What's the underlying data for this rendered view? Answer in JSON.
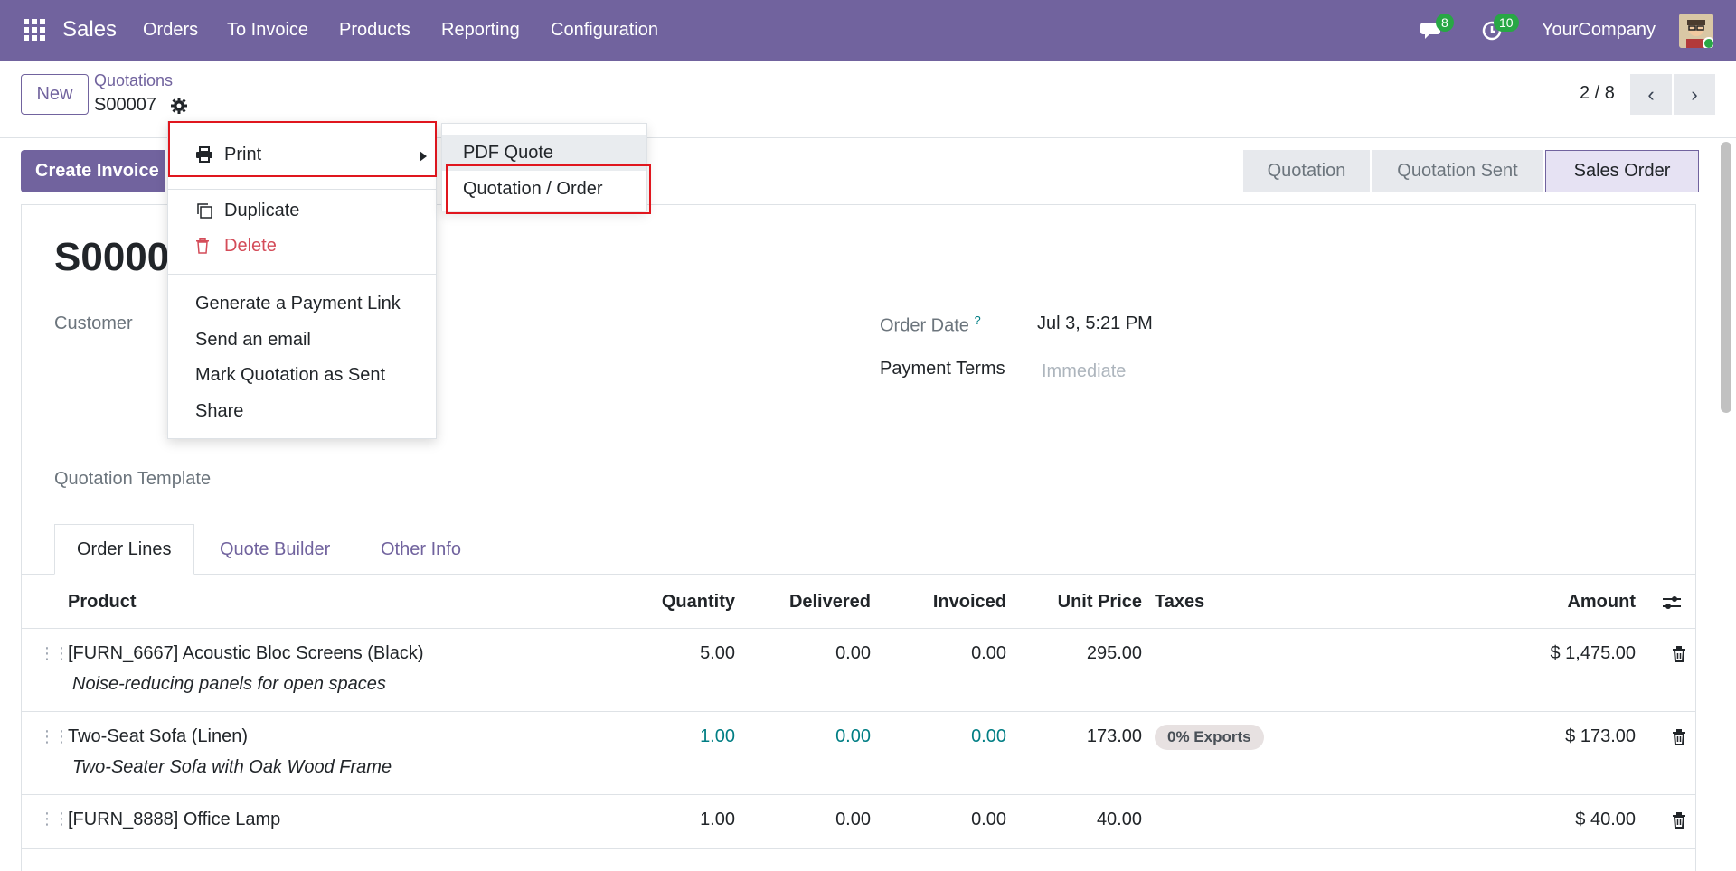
{
  "navbar": {
    "app": "Sales",
    "menus": [
      "Orders",
      "To Invoice",
      "Products",
      "Reporting",
      "Configuration"
    ],
    "messages_count": "8",
    "activities_count": "10",
    "company": "YourCompany"
  },
  "control": {
    "new_label": "New",
    "breadcrumb": "Quotations",
    "record": "S00007",
    "pager": "2 / 8"
  },
  "actions": {
    "create_invoice": "Create Invoice"
  },
  "statusbar": [
    "Quotation",
    "Quotation Sent",
    "Sales Order"
  ],
  "form": {
    "title": "S0000",
    "customer_label": "Customer",
    "order_date_label": "Order Date",
    "order_date_help": "?",
    "order_date": "Jul 3, 5:21 PM",
    "payment_terms_label": "Payment Terms",
    "payment_terms_placeholder": "Immediate",
    "template_label": "Quotation Template"
  },
  "tabs": [
    "Order Lines",
    "Quote Builder",
    "Other Info"
  ],
  "table": {
    "headers": {
      "product": "Product",
      "quantity": "Quantity",
      "delivered": "Delivered",
      "invoiced": "Invoiced",
      "unit_price": "Unit Price",
      "taxes": "Taxes",
      "amount": "Amount"
    },
    "rows": [
      {
        "product": "[FURN_6667] Acoustic Bloc Screens (Black)",
        "note": "Noise-reducing panels for open spaces",
        "quantity": "5.00",
        "delivered": "0.00",
        "invoiced": "0.00",
        "unit_price": "295.00",
        "tax": "",
        "amount": "$ 1,475.00"
      },
      {
        "product": "Two-Seat Sofa (Linen)",
        "note": "Two-Seater Sofa with Oak Wood Frame",
        "quantity": "1.00",
        "delivered": "0.00",
        "invoiced": "0.00",
        "unit_price": "173.00",
        "tax": "0% Exports",
        "amount": "$ 173.00"
      },
      {
        "product": "[FURN_8888] Office Lamp",
        "note": "",
        "quantity": "1.00",
        "delivered": "0.00",
        "invoiced": "0.00",
        "unit_price": "40.00",
        "tax": "",
        "amount": "$ 40.00"
      }
    ]
  },
  "menu": {
    "print": "Print",
    "duplicate": "Duplicate",
    "delete": "Delete",
    "payment_link": "Generate a Payment Link",
    "send_email": "Send an email",
    "mark_sent": "Mark Quotation as Sent",
    "share": "Share"
  },
  "submenu": {
    "pdf_quote": "PDF Quote",
    "quotation_order": "Quotation / Order"
  },
  "colors": {
    "brand": "#71639e",
    "highlight": "#e0161e",
    "teal": "#017e84",
    "danger": "#d44c59"
  }
}
